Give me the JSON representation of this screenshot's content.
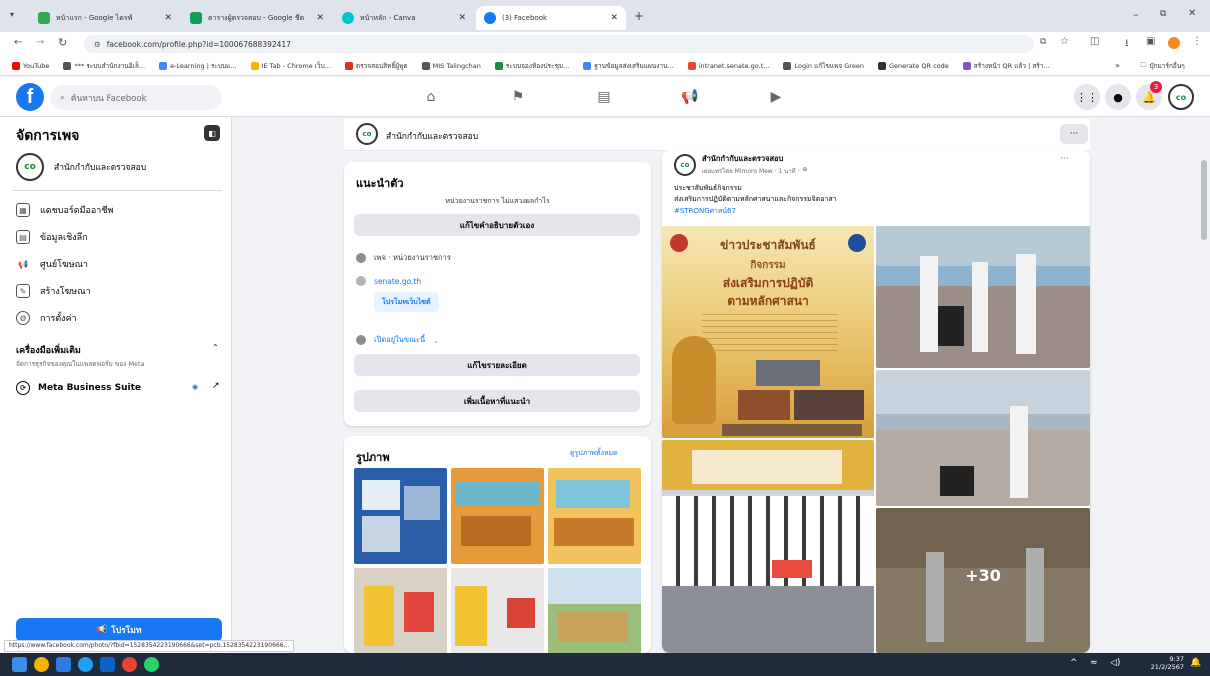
{
  "browser": {
    "tabs": [
      {
        "label": "หน้าแรก - Google ไดรฟ์",
        "color": "#34a853"
      },
      {
        "label": "ตารางผู้ตรวจสอบ - Google ชีต",
        "color": "#0f9d58"
      },
      {
        "label": "หน้าหลัก - Canva",
        "color": "#00c4cc"
      },
      {
        "label": "(3) Facebook",
        "color": "#1877f2"
      }
    ],
    "new_tab": "+",
    "url": "facebook.com/profile.php?id=100067688392417",
    "bookmarks": [
      "YouTube",
      "*** ระบบสำนักงานอิเล็...",
      "e-Learning | ระบบแ...",
      "IE Tab - Chrome เว็บ...",
      "ตรวจสอบสิทธิ์ผู้พูด",
      "MIS Talingchan",
      "ระบบจองห้องประชุม...",
      "ฐานข้อมูลส่งเสริมแผนงาน...",
      "intranet.senate.go.t...",
      "Login แก้ไขแพจ Green",
      "Generate QR code",
      "สร้างหน้า QR แล้ว | สร้า..."
    ],
    "bookmarks_folder": "บุ๊กมาร์กอื่นๆ"
  },
  "fb": {
    "logo": "f",
    "search_placeholder": "ค้นหาบน Facebook",
    "notif_count": "3"
  },
  "sidebar": {
    "title": "จัดการเพจ",
    "page_name": "สำนักกำกับและตรวจสอบ",
    "items": [
      "แดชบอร์ดมืออาชีพ",
      "ข้อมูลเชิงลึก",
      "ศูนย์โฆษณา",
      "สร้างโฆษณา",
      "การตั้งค่า"
    ],
    "tools_title": "เครื่องมือเพิ่มเติม",
    "tools_sub": "จัดการธุรกิจของคุณในแพลตฟอร์ม ของ Meta",
    "meta_suite": "Meta Business Suite",
    "promote_button": "โปรโมท"
  },
  "page_header": {
    "name": "สำนักกำกับและตรวจสอบ",
    "more": "···"
  },
  "intro": {
    "title": "แนะนำตัว",
    "subtitle": "หน่วยงานราชการ ไม่แสวงผลกำไร",
    "edit_bio": "แก้ไขคำอธิบายตัวเอง",
    "category": "เพจ · หน่วยงานราชการ",
    "website": "senate.go.th",
    "promote_website": "โปรโมทเว็บไซต์",
    "status": "เปิดอยู่ในขณะนี้",
    "edit_details": "แก้ไขรายละเอียด",
    "add_featured": "เพิ่มเนื้อหาที่แนะนำ"
  },
  "photos": {
    "title": "รูปภาพ",
    "see_all": "ดูรูปภาพทั้งหมด"
  },
  "post": {
    "author": "สำนักกำกับและตรวจสอบ",
    "meta": "เผยแพร่โดย Mimoro Mew · 1 นาที ·",
    "line1": "ประชาสัมพันธ์กิจกรรม",
    "line2": "ส่งเสริมการปฏิบัติตามหลักศาสนาและกิจกรรมจิตอาสา",
    "hashtag": "#STRONGศาสน์67",
    "poster_title": "ข่าวประชาสัมพันธ์",
    "poster_sub1": "กิจกรรม",
    "poster_sub2": "ส่งเสริมการปฏิบัติ",
    "poster_sub3": "ตามหลักศาสนา",
    "more_photos": "+30",
    "more": "···"
  },
  "status_url": "https://www.facebook.com/photo/?fbid=1528354223190666&set=pcb.1528354223190666...",
  "taskbar": {
    "time": "9:37",
    "date": "21/2/2567"
  }
}
